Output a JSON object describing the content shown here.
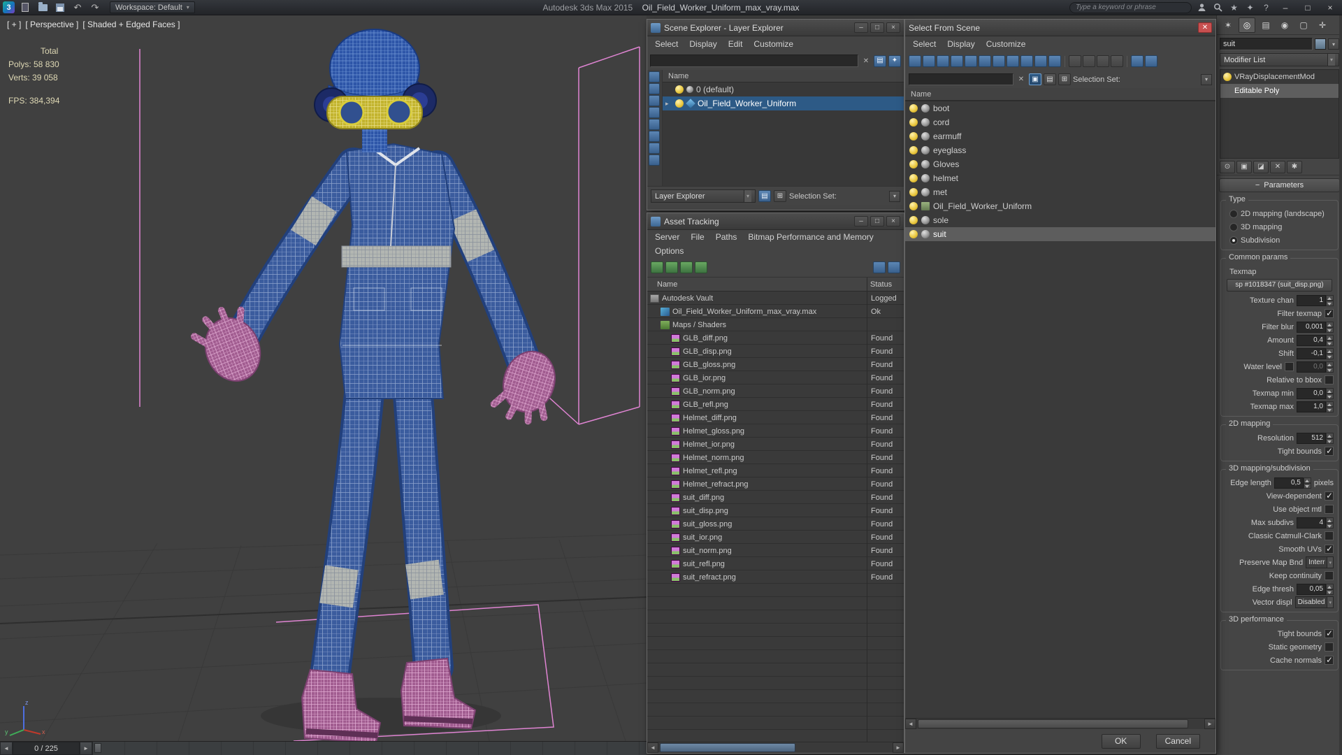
{
  "titlebar": {
    "product": "Autodesk 3ds Max 2015",
    "filename": "Oil_Field_Worker_Uniform_max_vray.max",
    "workspace": "Workspace: Default",
    "search_placeholder": "Type a keyword or phrase",
    "window_buttons": {
      "minimize": "–",
      "maximize": "□",
      "close": "×"
    },
    "help_icon_glyph": "?",
    "favorites_icon_glyph": "★",
    "community_icon_glyph": "✦"
  },
  "viewport": {
    "label_plus": "[ + ]",
    "label_view": "[ Perspective ]",
    "label_shading": "[ Shaded + Edged Faces ]",
    "stats_total": "Total",
    "stats_polys": "Polys: 58 830",
    "stats_verts": "Verts: 39 058",
    "stats_fps": "FPS: 384,394",
    "frame_indicator": "0 / 225",
    "axis_x": "x",
    "axis_y": "y",
    "axis_z": "z",
    "colors": {
      "viewport_bg": "#404040",
      "suit_blue": "#3b5c9e",
      "helmet_blue": "#2d55a8",
      "selection_pink": "#df84d2",
      "goggles_yellow": "#c3b42e"
    }
  },
  "scene_explorer": {
    "title": "Scene Explorer - Layer Explorer",
    "menu_select": "Select",
    "menu_display": "Display",
    "menu_edit": "Edit",
    "menu_customize": "Customize",
    "name_header": "Name",
    "rows": [
      {
        "label": "0 (default)",
        "selected": false
      },
      {
        "label": "Oil_Field_Worker_Uniform",
        "selected": true
      }
    ],
    "mode_combo": "Layer Explorer",
    "selection_set_label": "Selection Set:",
    "strip_icons": [
      {
        "name": "display-layers-icon",
        "glyph": "▤"
      },
      {
        "name": "display-objects-icon",
        "glyph": "○"
      },
      {
        "name": "display-shapes-icon",
        "glyph": "◆"
      },
      {
        "name": "display-lights-icon",
        "glyph": "☀"
      },
      {
        "name": "display-cameras-icon",
        "glyph": "■"
      },
      {
        "name": "display-helpers-icon",
        "glyph": "✚"
      },
      {
        "name": "display-materials-icon",
        "glyph": "◐"
      },
      {
        "name": "pick-mode-icon",
        "glyph": "▷"
      }
    ]
  },
  "asset_tracking": {
    "title": "Asset Tracking",
    "menu_server": "Server",
    "menu_file": "File",
    "menu_paths": "Paths",
    "menu_bitmap": "Bitmap Performance and Memory",
    "menu_options": "Options",
    "col_name": "Name",
    "col_status": "Status",
    "toolbar_icons": [
      {
        "name": "refresh-icon",
        "glyph": "↻"
      },
      {
        "name": "list-view-icon",
        "glyph": "▤"
      },
      {
        "name": "thumbnail-view-icon",
        "glyph": "▦"
      },
      {
        "name": "table-view-icon",
        "glyph": "▥"
      }
    ],
    "toolbar_right_icons": [
      {
        "name": "path-editor-icon",
        "glyph": "✦"
      },
      {
        "name": "settings-icon",
        "glyph": "✱"
      }
    ],
    "rows": [
      {
        "name": "Autodesk Vault",
        "status": "Logged",
        "indent": 0,
        "icon": "vault"
      },
      {
        "name": "Oil_Field_Worker_Uniform_max_vray.max",
        "status": "Ok",
        "indent": 1,
        "icon": "max"
      },
      {
        "name": "Maps / Shaders",
        "status": "",
        "indent": 1,
        "icon": "maps"
      },
      {
        "name": "GLB_diff.png",
        "status": "Found",
        "indent": 2,
        "icon": "png"
      },
      {
        "name": "GLB_disp.png",
        "status": "Found",
        "indent": 2,
        "icon": "png"
      },
      {
        "name": "GLB_gloss.png",
        "status": "Found",
        "indent": 2,
        "icon": "png"
      },
      {
        "name": "GLB_ior.png",
        "status": "Found",
        "indent": 2,
        "icon": "png"
      },
      {
        "name": "GLB_norm.png",
        "status": "Found",
        "indent": 2,
        "icon": "png"
      },
      {
        "name": "GLB_refl.png",
        "status": "Found",
        "indent": 2,
        "icon": "png"
      },
      {
        "name": "Helmet_diff.png",
        "status": "Found",
        "indent": 2,
        "icon": "png"
      },
      {
        "name": "Helmet_gloss.png",
        "status": "Found",
        "indent": 2,
        "icon": "png"
      },
      {
        "name": "Helmet_ior.png",
        "status": "Found",
        "indent": 2,
        "icon": "png"
      },
      {
        "name": "Helmet_norm.png",
        "status": "Found",
        "indent": 2,
        "icon": "png"
      },
      {
        "name": "Helmet_refl.png",
        "status": "Found",
        "indent": 2,
        "icon": "png"
      },
      {
        "name": "Helmet_refract.png",
        "status": "Found",
        "indent": 2,
        "icon": "png"
      },
      {
        "name": "suit_diff.png",
        "status": "Found",
        "indent": 2,
        "icon": "png"
      },
      {
        "name": "suit_disp.png",
        "status": "Found",
        "indent": 2,
        "icon": "png"
      },
      {
        "name": "suit_gloss.png",
        "status": "Found",
        "indent": 2,
        "icon": "png"
      },
      {
        "name": "suit_ior.png",
        "status": "Found",
        "indent": 2,
        "icon": "png"
      },
      {
        "name": "suit_norm.png",
        "status": "Found",
        "indent": 2,
        "icon": "png"
      },
      {
        "name": "suit_refl.png",
        "status": "Found",
        "indent": 2,
        "icon": "png"
      },
      {
        "name": "suit_refract.png",
        "status": "Found",
        "indent": 2,
        "icon": "png"
      }
    ]
  },
  "select_from_scene": {
    "title": "Select From Scene",
    "menu_select": "Select",
    "menu_display": "Display",
    "menu_customize": "Customize",
    "selection_set_label": "Selection Set:",
    "name_header": "Name",
    "filter_icons": [
      {
        "name": "display-geometry-icon",
        "glyph": "●"
      },
      {
        "name": "display-shapes-icon",
        "glyph": "◆"
      },
      {
        "name": "display-lights-icon",
        "glyph": "☀"
      },
      {
        "name": "display-cameras-icon",
        "glyph": "■"
      },
      {
        "name": "display-helpers-icon",
        "glyph": "✚"
      },
      {
        "name": "display-spacewarps-icon",
        "glyph": "◠"
      },
      {
        "name": "display-groups-icon",
        "glyph": "▣"
      },
      {
        "name": "display-xrefs-icon",
        "glyph": "◇"
      },
      {
        "name": "display-bones-icon",
        "glyph": "✶"
      },
      {
        "name": "display-containers-icon",
        "glyph": "▲"
      },
      {
        "name": "display-materials-icon",
        "glyph": "◐"
      }
    ],
    "view_icons": [
      {
        "name": "list-view-icon",
        "glyph": "≡"
      },
      {
        "name": "detail-view-icon",
        "glyph": "▤"
      },
      {
        "name": "hierarchy-view-icon",
        "glyph": "▦"
      },
      {
        "name": "column-view-icon",
        "glyph": "▥"
      }
    ],
    "tail_icons": [
      {
        "name": "filter-funnel-icon",
        "glyph": "▼"
      },
      {
        "name": "combine-icon",
        "glyph": "⊞"
      }
    ],
    "items": [
      {
        "label": "boot",
        "icon": "sphere"
      },
      {
        "label": "cord",
        "icon": "sphere"
      },
      {
        "label": "earmuff",
        "icon": "sphere"
      },
      {
        "label": "eyeglass",
        "icon": "sphere"
      },
      {
        "label": "Gloves",
        "icon": "sphere"
      },
      {
        "label": "helmet",
        "icon": "sphere"
      },
      {
        "label": "met",
        "icon": "sphere"
      },
      {
        "label": "Oil_Field_Worker_Uniform",
        "icon": "group"
      },
      {
        "label": "sole",
        "icon": "sphere"
      },
      {
        "label": "suit",
        "icon": "sphere",
        "selected": true
      }
    ],
    "ok_label": "OK",
    "cancel_label": "Cancel"
  },
  "command_panel": {
    "object_name": "suit",
    "modifier_list_label": "Modifier List",
    "tabs": [
      {
        "name": "tab-create-icon",
        "glyph": "✶"
      },
      {
        "name": "tab-modify-icon",
        "glyph": "◎",
        "active": true
      },
      {
        "name": "tab-hierarchy-icon",
        "glyph": "▤"
      },
      {
        "name": "tab-motion-icon",
        "glyph": "◉"
      },
      {
        "name": "tab-display-icon",
        "glyph": "▢"
      },
      {
        "name": "tab-utilities-icon",
        "glyph": "✛"
      }
    ],
    "stack": [
      {
        "label": "VRayDisplacementMod",
        "icon": "bulb"
      },
      {
        "label": "Editable Poly",
        "icon": "none",
        "selected": true
      }
    ],
    "stack_tools": [
      {
        "name": "pin-stack-icon",
        "glyph": "⊙"
      },
      {
        "name": "show-end-result-icon",
        "glyph": "▣"
      },
      {
        "name": "make-unique-icon",
        "glyph": "◪"
      },
      {
        "name": "remove-modifier-icon",
        "glyph": "✕"
      },
      {
        "name": "configure-modifier-sets-icon",
        "glyph": "✱"
      }
    ],
    "rollout_title": "Parameters",
    "type_group": {
      "title": "Type",
      "options": [
        {
          "label": "2D mapping (landscape)",
          "on": false
        },
        {
          "label": "3D mapping",
          "on": false
        },
        {
          "label": "Subdivision",
          "on": true
        }
      ]
    },
    "common": {
      "title": "Common params",
      "texmap_label": "Texmap",
      "texmap_button": "sp #1018347 (suit_disp.png)",
      "texture_chan": {
        "label": "Texture chan",
        "value": "1"
      },
      "filter_texmap": {
        "label": "Filter texmap",
        "checked": true
      },
      "filter_blur": {
        "label": "Filter blur",
        "value": "0,001"
      },
      "amount": {
        "label": "Amount",
        "value": "0,4"
      },
      "shift": {
        "label": "Shift",
        "value": "-0,1"
      },
      "water_level": {
        "label": "Water level",
        "value": "0,0",
        "checked": false
      },
      "relative_bbox": {
        "label": "Relative to bbox",
        "checked": false
      },
      "texmap_min": {
        "label": "Texmap min",
        "value": "0,0"
      },
      "texmap_max": {
        "label": "Texmap max",
        "value": "1,0"
      }
    },
    "mapping2d": {
      "title": "2D mapping",
      "resolution": {
        "label": "Resolution",
        "value": "512"
      },
      "tight_bounds": {
        "label": "Tight bounds",
        "checked": true
      }
    },
    "mapping3d": {
      "title": "3D mapping/subdivision",
      "edge_length": {
        "label": "Edge length",
        "value": "0,5",
        "suffix": "pixels"
      },
      "view_dependent": {
        "label": "View-dependent",
        "checked": true
      },
      "use_object_mtl": {
        "label": "Use object mtl",
        "checked": false
      },
      "max_subdivs": {
        "label": "Max subdivs",
        "value": "4"
      },
      "classic_catmull": {
        "label": "Classic Catmull-Clark",
        "checked": false
      },
      "smooth_uvs": {
        "label": "Smooth UVs",
        "checked": true
      },
      "preserve_map_bnd": {
        "label": "Preserve Map Bnd",
        "value": "Interr"
      },
      "keep_continuity": {
        "label": "Keep continuity",
        "checked": false
      },
      "edge_thresh": {
        "label": "Edge thresh",
        "value": "0,05"
      },
      "vector_displ": {
        "label": "Vector displ",
        "value": "Disabled"
      }
    },
    "performance3d": {
      "title": "3D performance",
      "tight_bounds": {
        "label": "Tight bounds",
        "checked": true
      },
      "static_geometry": {
        "label": "Static geometry",
        "checked": false
      },
      "cache_normals": {
        "label": "Cache normals",
        "checked": true
      }
    }
  }
}
